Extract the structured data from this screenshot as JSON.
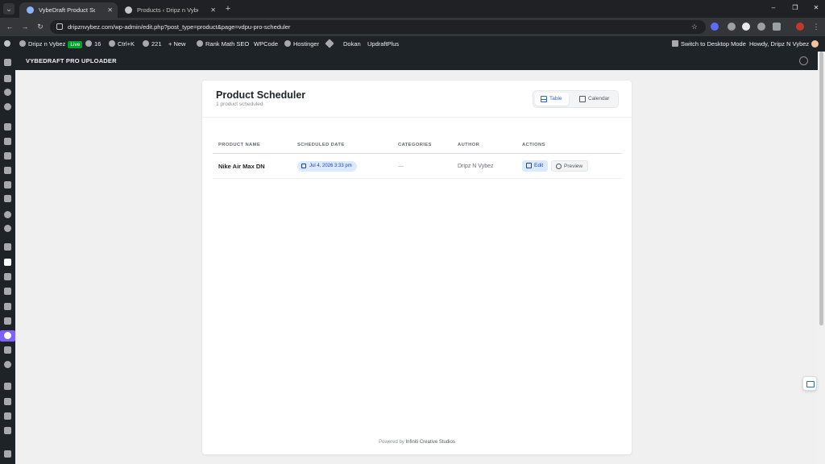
{
  "browser": {
    "tabs": [
      {
        "title": "VybeDraft Product Scheduler ‹",
        "active": true
      },
      {
        "title": "Products ‹ Dripz n Vybez — Wo",
        "active": false
      }
    ],
    "url": "dripznvybez.com/wp-admin/edit.php?post_type=product&page=vdpu-pro-scheduler",
    "icons": {
      "back": "←",
      "forward": "→",
      "reload": "↻",
      "star": "☆",
      "new_tab": "+",
      "close": "✕",
      "menu": "⌄",
      "minimize": "–",
      "maximize": "❒",
      "window_close": "✕"
    }
  },
  "adminbar": {
    "site_name": "Dripz n Vybez",
    "live_badge": "Live",
    "updates_count": "16",
    "search_shortcut": "Ctrl+K",
    "comments_count": "221",
    "new_label": "+ New",
    "rank_math": "Rank Math SEO",
    "wpcode": "WPCode",
    "hostinger": "Hostinger",
    "dokan": "Dokan",
    "updraft": "UpdraftPlus",
    "switch_desktop": "Switch to Desktop Mode",
    "howdy": "Howdy, Dripz N Vybez"
  },
  "plugin": {
    "title": "VYBEDRAFT PRO UPLOADER"
  },
  "scheduler": {
    "title": "Product Scheduler",
    "subtitle": "1 product scheduled",
    "view_table": "Table",
    "view_calendar": "Calendar",
    "columns": [
      "PRODUCT NAME",
      "SCHEDULED DATE",
      "CATEGORIES",
      "AUTHOR",
      "ACTIONS"
    ],
    "rows": [
      {
        "product": "Nike Air Max DN",
        "scheduled": "Jul 4, 2026 3:33 pm",
        "categories": "—",
        "author": "Dripz N Vybez",
        "edit": "Edit",
        "preview": "Preview"
      }
    ],
    "footer_prefix": "Powered by ",
    "footer_brand": "Infiniti Creative Studios"
  },
  "colors": {
    "accent": "#2563eb",
    "pill_bg": "#dbeafe",
    "admin_bg": "#1d2327",
    "live_green": "#00a32a",
    "highlight_purple": "#7b61ff"
  }
}
